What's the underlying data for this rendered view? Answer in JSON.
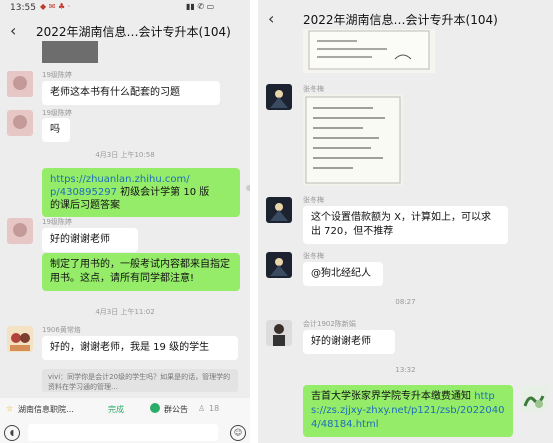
{
  "left": {
    "status": {
      "time": "13:55"
    },
    "header": {
      "title": "2022年湖南信息…会计专升本(104)",
      "back": "‹"
    },
    "messages": [
      {
        "nick": "19级陈婷",
        "text": "老师这本书有什么配套的习题"
      },
      {
        "nick": "19级陈婷",
        "text": "吗"
      },
      {
        "timestamp": "4月3日 上午10:58"
      },
      {
        "link": "https://zhuanlan.zhihu.com/p/430895297",
        "link_a": "https://zhuanlan.zhihu.com/",
        "link_b": "p/430895297",
        "text_a": "初级会计学第 10 版",
        "text_b": "的课后习题答案"
      },
      {
        "nick": "19级陈婷",
        "text": "好的谢谢老师"
      },
      {
        "text": "制定了用书的，一般考试内容都来自指定用书。这点，请所有同学都注意!"
      },
      {
        "timestamp": "4月3日 上午11:02"
      },
      {
        "nick": "1906黄常烙",
        "text": "好的，谢谢老师，我是 19 级的学生"
      }
    ],
    "quote": "vivi：同学你是会计20级的学生吗？如果是的话，管理学的资料在学习通的管理…",
    "bottom": {
      "pinned": "湖南信息职院…",
      "done": "完成",
      "announce": "群公告",
      "count": "18"
    }
  },
  "right": {
    "header": {
      "title": "2022年湖南信息…会计专升本(104)",
      "back": "‹"
    },
    "messages": [
      {
        "nick": "张冬梅"
      },
      {
        "nick": "张冬梅",
        "text": "这个设置借款额为 X，计算如上，可以求出 720，但不推荐"
      },
      {
        "nick": "张冬梅",
        "text": "@狗北经纪人"
      },
      {
        "timestamp": "08:27"
      },
      {
        "nick": "会计1902陈新娟",
        "text": "好的谢谢老师"
      },
      {
        "timestamp": "13:32"
      },
      {
        "text_a": "吉首大学张家界学院专升本缴费通知 ",
        "link": "https://zs.zjjxy-zhxy.net/p121/zsb/20220404/48184.html"
      }
    ]
  },
  "colors": {
    "my_bubble": "#95ec69",
    "bubble": "#ffffff",
    "bg": "#ededed",
    "link": "#1d6fb8",
    "done": "#2aae67"
  }
}
